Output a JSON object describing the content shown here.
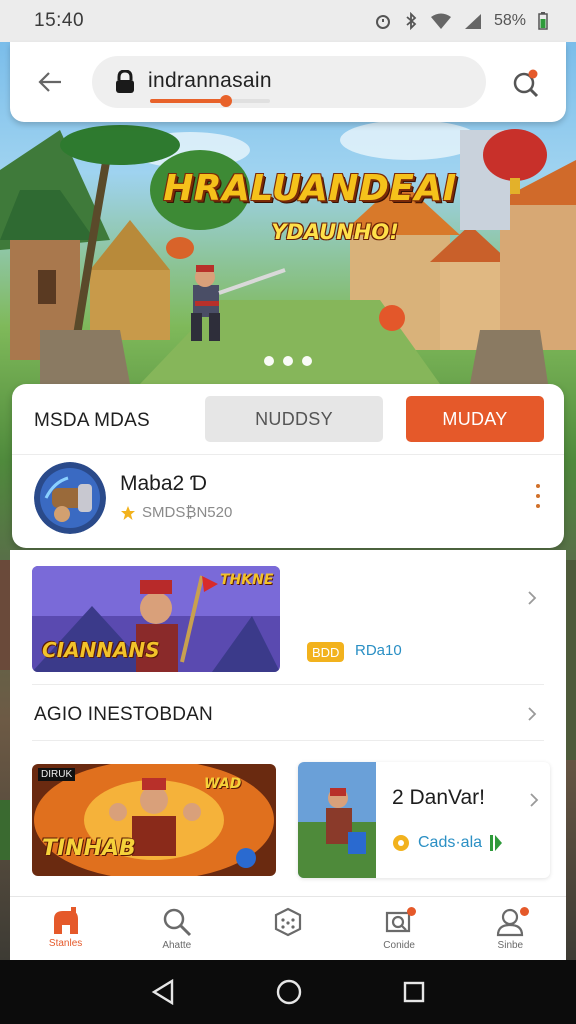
{
  "status_bar": {
    "time": "15:40",
    "battery": "58%",
    "icons": [
      "alarm-icon",
      "bluetooth-icon",
      "wifi-icon",
      "signal-icon",
      "battery-icon"
    ]
  },
  "search": {
    "value": "indrannasain",
    "progress": 0.63,
    "icons": [
      "back-arrow-icon",
      "lock-icon",
      "notification-search-icon"
    ]
  },
  "hero": {
    "title": "HRALUANDEAI",
    "subtitle": "YDAUNHO!",
    "carousel_dots": 3
  },
  "panel": {
    "title": "MSDA MDAS",
    "tabs": [
      {
        "label": "NUDDSY",
        "active": false
      },
      {
        "label": "MUDAY",
        "active": true
      }
    ],
    "app": {
      "name": "Maba2  Ɗ",
      "rating_text": "SMDS₿N520"
    }
  },
  "list": {
    "item1": {
      "banner_text": "CIANNANS",
      "banner_tag": "THKNE",
      "tag_pill": "BDD",
      "tag_text": "RDa10"
    },
    "section_title": "AGIO INESTOBDAN",
    "item2": {
      "banner_top": "DIRUK",
      "banner_text": "TINHAB",
      "banner_small": "WAD"
    },
    "item3": {
      "title": "2 DanVar!",
      "subtitle": "Cads·ala"
    }
  },
  "bottom_nav": [
    {
      "label": "Stanles",
      "icon": "home-icon",
      "active": true
    },
    {
      "label": "Ahatte",
      "icon": "search-icon",
      "active": false
    },
    {
      "label": "",
      "icon": "grid-dice-icon",
      "active": false
    },
    {
      "label": "Conide",
      "icon": "notification-icon",
      "active": false
    },
    {
      "label": "Sinbe",
      "icon": "profile-icon",
      "active": false
    }
  ],
  "colors": {
    "accent": "#e5592a",
    "accent_yellow": "#f2b21d",
    "link_blue": "#2a8fc4"
  }
}
